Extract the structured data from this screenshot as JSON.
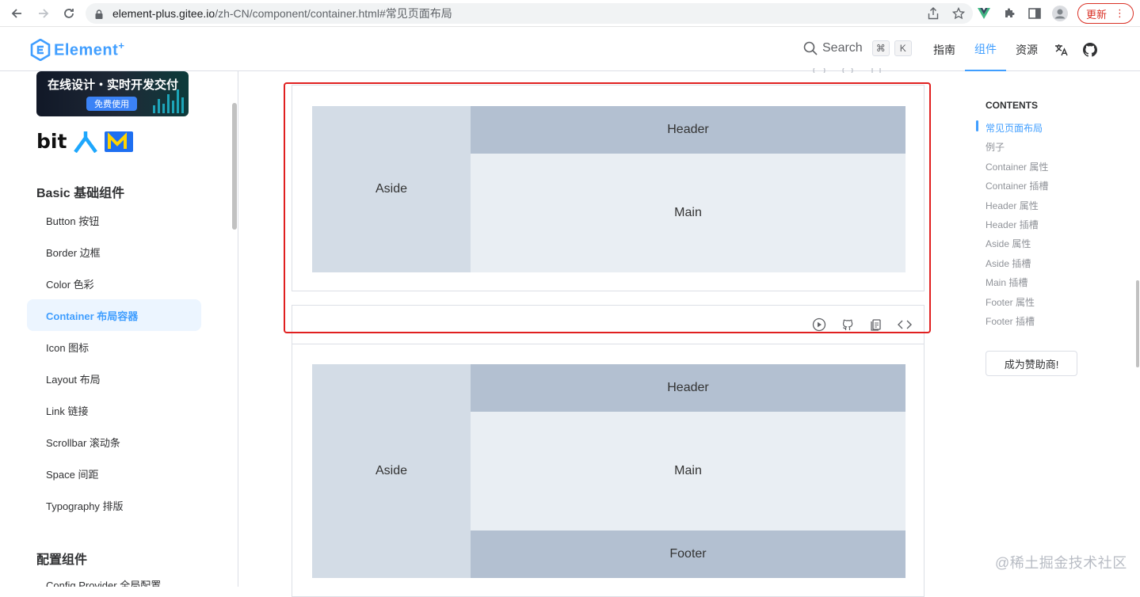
{
  "browser": {
    "url_host": "element-plus.gitee.io",
    "url_path": "/zh-CN/component/container.html#常见页面布局",
    "update_label": "更新"
  },
  "header": {
    "logo_text": "Element",
    "logo_sup": "+",
    "search_label": "Search",
    "kbd_cmd": "⌘",
    "kbd_k": "K",
    "nav": [
      "指南",
      "组件",
      "资源"
    ]
  },
  "sidebar": {
    "ad_title": "在线设计・实时开发交付",
    "ad_button": "免费使用",
    "brand_text": "bit",
    "section1": "Basic 基础组件",
    "items": [
      "Button 按钮",
      "Border 边框",
      "Color 色彩",
      "Container 布局容器",
      "Icon 图标",
      "Layout 布局",
      "Link 链接",
      "Scrollbar 滚动条",
      "Space 间距",
      "Typography 排版"
    ],
    "active_index": 3,
    "section2": "配置组件",
    "partial_item": "Config Provider 全局配置"
  },
  "demo1": {
    "aside": "Aside",
    "header": "Header",
    "main": "Main"
  },
  "demo2": {
    "aside": "Aside",
    "header": "Header",
    "main": "Main",
    "footer": "Footer"
  },
  "toc": {
    "title": "CONTENTS",
    "items": [
      "常见页面布局",
      "例子",
      "Container 属性",
      "Container 插槽",
      "Header 属性",
      "Header 插槽",
      "Aside 属性",
      "Aside 插槽",
      "Main 插槽",
      "Footer 属性",
      "Footer 插槽"
    ],
    "sponsor": "成为赞助商!"
  },
  "watermark": "@稀土掘金技术社区",
  "colors": {
    "accent": "#409eff",
    "aside": "#d3dce6",
    "header_footer": "#b3c0d1",
    "main": "#e9eef3",
    "highlight": "#e02020"
  }
}
